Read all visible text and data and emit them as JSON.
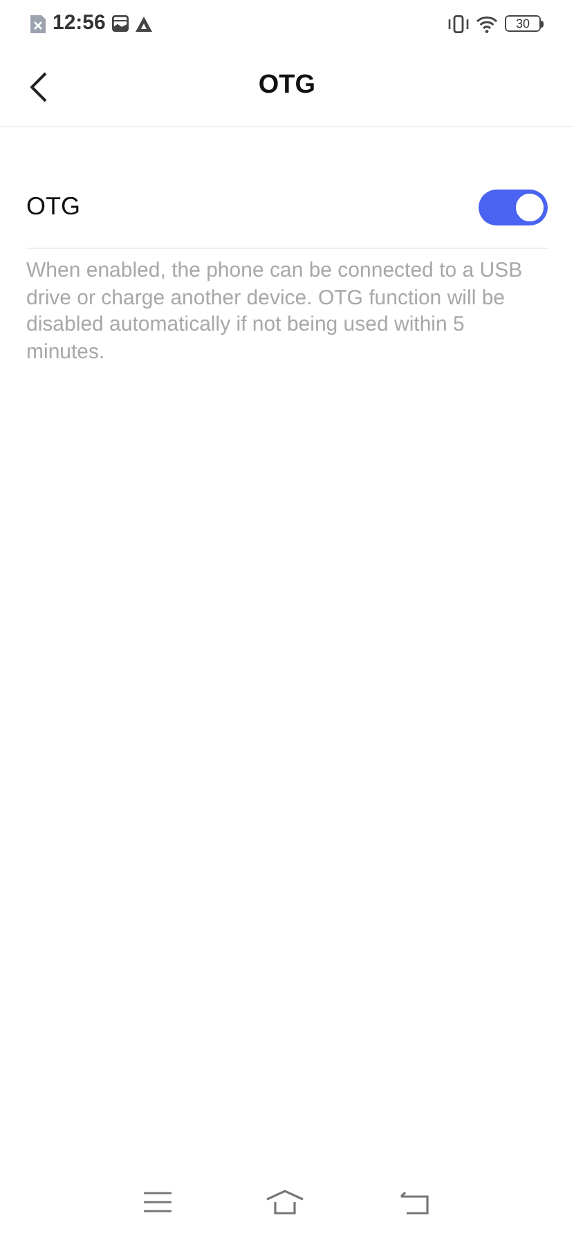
{
  "status_bar": {
    "time": "12:56",
    "battery": "30"
  },
  "header": {
    "title": "OTG"
  },
  "setting": {
    "label": "OTG",
    "on": true,
    "description": "When enabled, the phone can be connected to a USB drive or charge another device. OTG function will be disabled automatically if not being used within 5 minutes."
  }
}
